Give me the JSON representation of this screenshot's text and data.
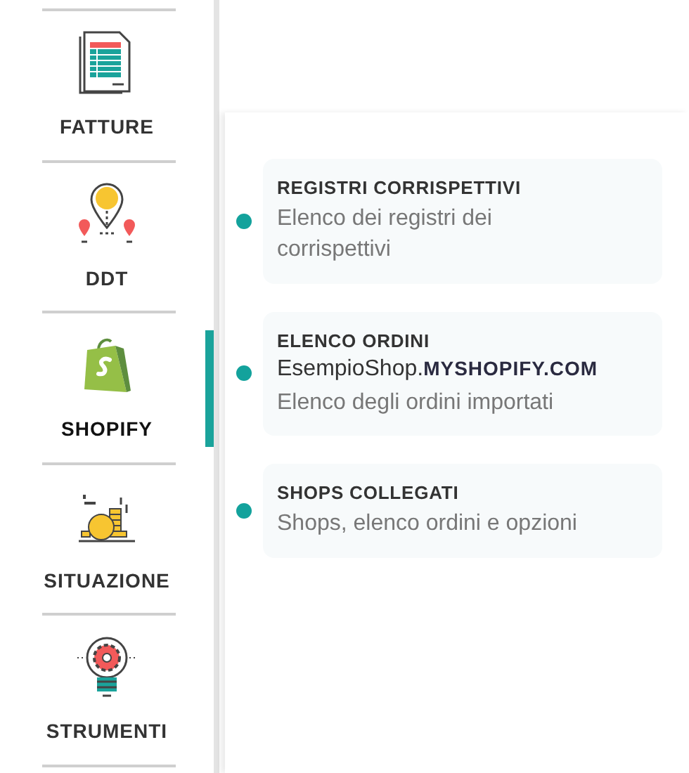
{
  "sidebar": {
    "items": [
      {
        "label": "FATTURE",
        "kind": "invoice",
        "selected": false
      },
      {
        "label": "DDT",
        "kind": "ddt",
        "selected": false
      },
      {
        "label": "SHOPIFY",
        "kind": "bag",
        "selected": true
      },
      {
        "label": "SITUAZIONE",
        "kind": "coins",
        "selected": false
      },
      {
        "label": "STRUMENTI",
        "kind": "bulb",
        "selected": false
      }
    ]
  },
  "submenu": {
    "items": [
      {
        "title": "REGISTRI CORRISPETTIVI",
        "description": "Elenco dei registri dei corrispettivi"
      },
      {
        "title": "ELENCO ORDINI",
        "shop": "EsempioShop.**MYSHOPIFY.COM**",
        "description": "Elenco degli ordini importati"
      },
      {
        "title": "SHOPS COLLEGATI",
        "description": "Shops, elenco ordini e opzioni"
      }
    ]
  }
}
